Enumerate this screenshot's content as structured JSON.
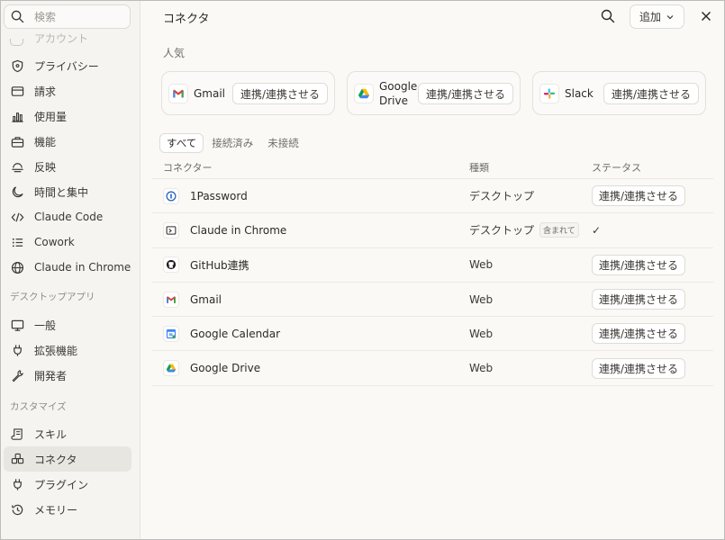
{
  "sidebar": {
    "search_placeholder": "検索",
    "faded_item": "アカウント",
    "items": [
      {
        "label": "プライバシー",
        "icon": "shield-icon"
      },
      {
        "label": "請求",
        "icon": "credit-card-icon"
      },
      {
        "label": "使用量",
        "icon": "bar-chart-icon"
      },
      {
        "label": "機能",
        "icon": "toolbox-icon"
      },
      {
        "label": "反映",
        "icon": "reflect-icon"
      },
      {
        "label": "時間と集中",
        "icon": "moon-icon"
      },
      {
        "label": "Claude Code",
        "icon": "code-icon"
      },
      {
        "label": "Cowork",
        "icon": "list-icon"
      },
      {
        "label": "Claude in Chrome",
        "icon": "globe-icon"
      }
    ],
    "desktop_section": "デスクトップアプリ",
    "desktop_items": [
      {
        "label": "一般",
        "icon": "monitor-icon"
      },
      {
        "label": "拡張機能",
        "icon": "plug-icon"
      },
      {
        "label": "開発者",
        "icon": "wrench-icon"
      }
    ],
    "customize_section": "カスタマイズ",
    "customize_items": [
      {
        "label": "スキル",
        "icon": "scroll-icon"
      },
      {
        "label": "コネクタ",
        "icon": "connector-icon"
      },
      {
        "label": "プラグイン",
        "icon": "plug-icon"
      },
      {
        "label": "メモリー",
        "icon": "history-icon"
      }
    ]
  },
  "header": {
    "title": "コネクタ",
    "add_label": "追加"
  },
  "popular": {
    "label": "人気",
    "cards": [
      {
        "name": "Gmail",
        "button": "連携/連携させる"
      },
      {
        "name": "Google\nDrive",
        "button": "連携/連携させる"
      },
      {
        "name": "Slack",
        "button": "連携/連携させる"
      }
    ]
  },
  "filters": [
    "すべて",
    "接続済み",
    "未接続"
  ],
  "table": {
    "headers": [
      "コネクター",
      "種類",
      "ステータス"
    ],
    "rows": [
      {
        "name": "1Password",
        "type": "デスクトップ",
        "status": "連携/連携させる"
      },
      {
        "name": "Claude in Chrome",
        "type": "デスクトップ",
        "badge": "含まれて",
        "status": "✓"
      },
      {
        "name": "GitHub連携",
        "type": "Web",
        "status": "連携/連携させる"
      },
      {
        "name": "Gmail",
        "type": "Web",
        "status": "連携/連携させる"
      },
      {
        "name": "Google Calendar",
        "type": "Web",
        "status": "連携/連携させる"
      },
      {
        "name": "Google Drive",
        "type": "Web",
        "status": "連携/連携させる"
      }
    ]
  }
}
